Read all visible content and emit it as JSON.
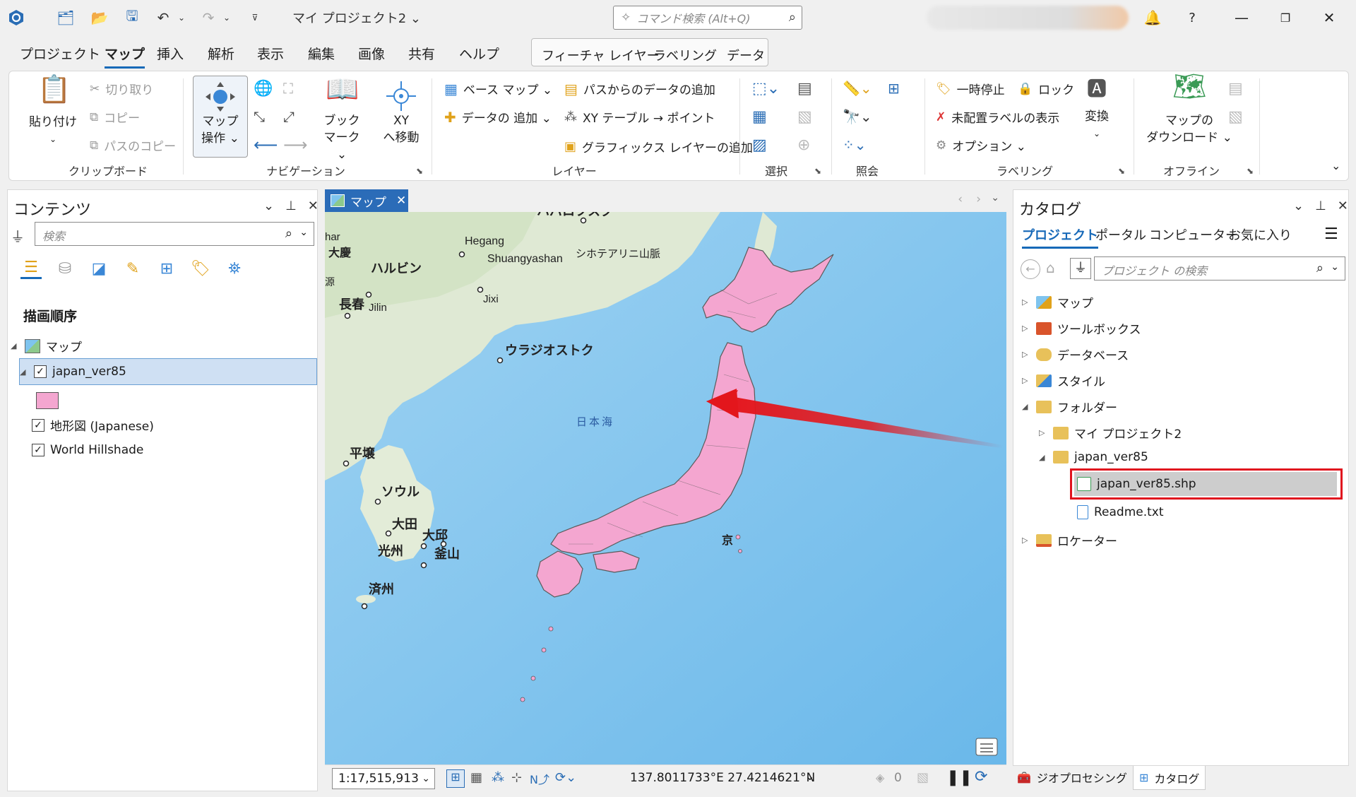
{
  "titlebar": {
    "project_title": "マイ プロジェクト2 ⌄",
    "command_search_placeholder": "コマンド検索 (Alt+Q)",
    "help": "?"
  },
  "menu": {
    "tabs": [
      "プロジェクト",
      "マップ",
      "挿入",
      "解析",
      "表示",
      "編集",
      "画像",
      "共有",
      "ヘルプ"
    ],
    "active": "マップ",
    "context_tabs": [
      "フィーチャ レイヤー",
      "ラベリング",
      "データ"
    ]
  },
  "ribbon": {
    "clipboard": {
      "paste": "貼り付け",
      "cut": "切り取り",
      "copy": "コピー",
      "copy_path": "パスのコピー",
      "group": "クリップボード"
    },
    "navigation": {
      "explore_line1": "マップ",
      "explore_line2": "操作 ⌄",
      "bookmarks_line1": "ブック",
      "bookmarks_line2": "マーク ⌄",
      "goto_line1": "XY",
      "goto_line2": "へ移動",
      "group": "ナビゲーション"
    },
    "layer": {
      "basemap": "ベース マップ ⌄",
      "add_data": "データの 追加 ⌄",
      "add_from_path": "パスからのデータの追加",
      "xy_table": "XY テーブル → ポイント",
      "add_graphics": "グラフィックス レイヤーの追加",
      "group": "レイヤー"
    },
    "selection": {
      "group": "選択"
    },
    "inquiry": {
      "group": "照会"
    },
    "labeling": {
      "pause": "一時停止",
      "lock": "ロック",
      "unplaced": "未配置ラベルの表示",
      "options": "オプション ⌄",
      "convert": "変換",
      "group": "ラベリング"
    },
    "offline": {
      "download_line1": "マップの",
      "download_line2": "ダウンロード ⌄",
      "group": "オフライン"
    }
  },
  "contents": {
    "title": "コンテンツ",
    "search_placeholder": "検索",
    "section": "描画順序",
    "map_name": "マップ",
    "layers": [
      {
        "name": "japan_ver85",
        "checked": true,
        "selected": true
      },
      {
        "name": "地形図 (Japanese)",
        "checked": true
      },
      {
        "name": "World Hillshade",
        "checked": true
      }
    ],
    "symbol_color": "#f4a6d0"
  },
  "mapview": {
    "tab_label": "マップ",
    "scale": "1:17,515,913",
    "coordinates": "137.8011733°E 27.4214621°N",
    "count": "0",
    "labels": {
      "harbin": "ハルビン",
      "changchun": "長春",
      "jilin": "Jilin",
      "hegang": "Hegang",
      "shuangyashan": "Shuangyashan",
      "sikhote": "シホテアリニ山脈",
      "jixi": "Jixi",
      "vladivostok": "ウラジオストク",
      "sea_of_japan": "日本海",
      "pyongyang": "平壌",
      "seoul": "ソウル",
      "daejeon": "大田",
      "daegu": "大邱",
      "gwangju": "光州",
      "busan": "釜山",
      "jeju": "済州",
      "daqing": "大慶",
      "khabarovsk": "ハバロフスク",
      "har": "har",
      "gen": "源",
      "tokyo_part": "京"
    }
  },
  "catalog": {
    "title": "カタログ",
    "tabs": [
      "プロジェクト",
      "ポータル",
      "コンピューター",
      "お気に入り"
    ],
    "active_tab": "プロジェクト",
    "search_placeholder": "プロジェクト の検索",
    "tree": [
      {
        "label": "マップ",
        "level": 0,
        "expand": "collapsed"
      },
      {
        "label": "ツールボックス",
        "level": 0,
        "expand": "collapsed"
      },
      {
        "label": "データベース",
        "level": 0,
        "expand": "collapsed"
      },
      {
        "label": "スタイル",
        "level": 0,
        "expand": "collapsed"
      },
      {
        "label": "フォルダー",
        "level": 0,
        "expand": "expanded"
      },
      {
        "label": "マイ プロジェクト2",
        "level": 1,
        "expand": "collapsed"
      },
      {
        "label": "japan_ver85",
        "level": 1,
        "expand": "expanded"
      },
      {
        "label": "japan_ver85.shp",
        "level": 2,
        "expand": "none",
        "highlighted": true
      },
      {
        "label": "Readme.txt",
        "level": 2,
        "expand": "none"
      },
      {
        "label": "ロケーター",
        "level": 0,
        "expand": "collapsed"
      }
    ]
  },
  "bottom_tabs": {
    "geoprocessing": "ジオプロセシング",
    "catalog": "カタログ"
  },
  "colors": {
    "accent": "#1769b8",
    "highlight_border": "#e0141e",
    "arrow": "#e3161c",
    "selected_row": "#cfe0f3"
  }
}
